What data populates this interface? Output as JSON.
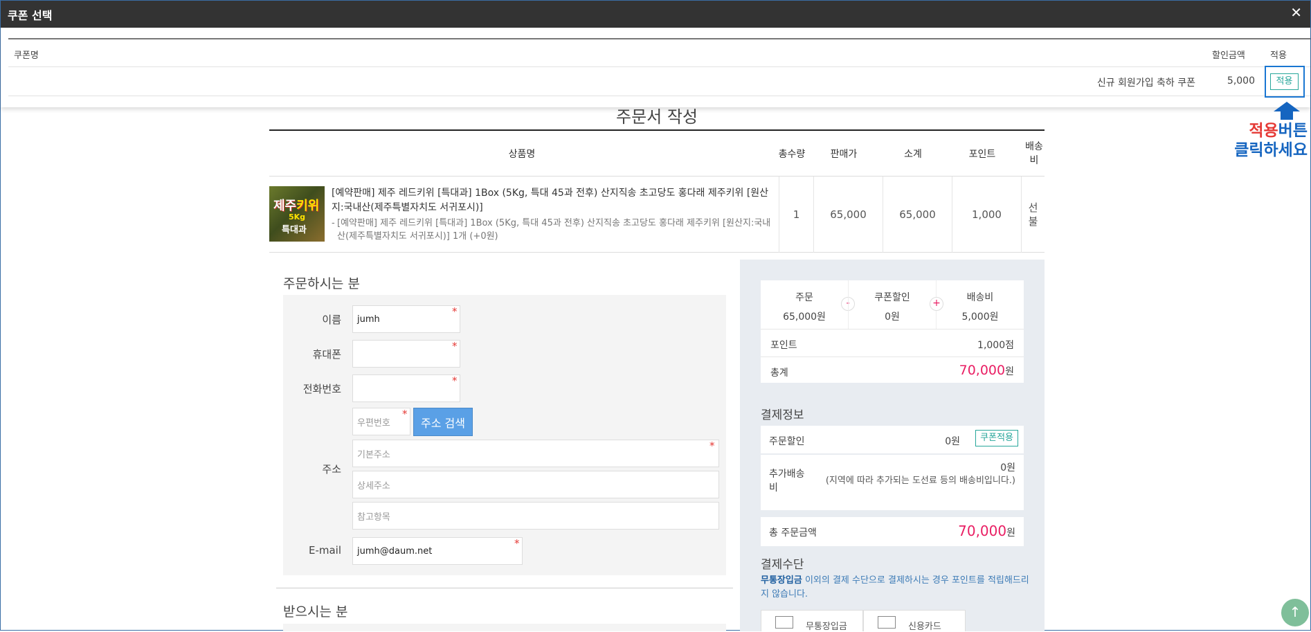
{
  "modal": {
    "title": "쿠폰 선택",
    "close": "✕",
    "columns": {
      "name": "쿠폰명",
      "discount": "할인금액",
      "apply": "적용"
    },
    "coupons": [
      {
        "name": "신규 회원가입 축하 쿠폰",
        "discount": "5,000",
        "apply_label": "적용"
      }
    ]
  },
  "annotation": {
    "red": "적용",
    "blue1": "버튼",
    "blue2": "클릭하세요"
  },
  "order": {
    "title": "주문서 작성",
    "columns": {
      "product": "상품명",
      "qty": "총수량",
      "price": "판매가",
      "subtotal": "소계",
      "point": "포인트",
      "ship": "배송비"
    },
    "item": {
      "thumb_line1a": "제주",
      "thumb_line1b": "키위",
      "thumb_line2": "5Kg",
      "thumb_line3": "특대과",
      "name": "[예약판매] 제주 레드키위 [특대과] 1Box (5Kg, 특대 45과 전후) 산지직송 초고당도 홍다래 제주키위 [원산지:국내산(제주특별자치도 서귀포시)]",
      "option": "[예약판매] 제주 레드키위 [특대과] 1Box (5Kg, 특대 45과 전후) 산지직송 초고당도 홍다래 제주키위 [원산지:국내산(제주특별자치도 서귀포시)] 1개 (+0원)",
      "option_bullet": "-",
      "qty": "1",
      "price": "65,000",
      "subtotal": "65,000",
      "point": "1,000",
      "ship": "선불"
    }
  },
  "orderer": {
    "title": "주문하시는 분",
    "name_label": "이름",
    "name_value": "jumh",
    "phone_label": "휴대폰",
    "tel_label": "전화번호",
    "zip_placeholder": "우편번호",
    "addr_search": "주소 검색",
    "addr_label": "주소",
    "addr1_placeholder": "기본주소",
    "addr2_placeholder": "상세주소",
    "addr3_placeholder": "참고항목",
    "email_label": "E-mail",
    "email_value": "jumh@daum.net",
    "req_mark": "*"
  },
  "receiver": {
    "title": "받으시는 분"
  },
  "summary": {
    "order_label": "주문",
    "order_value": "65,000원",
    "coupon_label": "쿠폰할인",
    "coupon_value": "0원",
    "ship_label": "배송비",
    "ship_value": "5,000원",
    "minus": "-",
    "plus": "+",
    "point_label": "포인트",
    "point_value": "1,000점",
    "total_label": "총계",
    "total_amount": "70,000",
    "total_unit": "원"
  },
  "payinfo": {
    "title": "결제정보",
    "discount_label": "주문할인",
    "discount_value": "0원",
    "coupon_btn": "쿠폰적용",
    "extra_label": "추가배송비",
    "extra_value": "0원",
    "extra_note": "(지역에 따라 추가되는 도선료 등의 배송비입니다.)",
    "grand_label": "총 주문금액",
    "grand_amount": "70,000",
    "grand_unit": "원"
  },
  "paymethod": {
    "title": "결제수단",
    "note_bold": "무통장입금",
    "note_rest": " 이외의 결제 수단으로 결제하시는 경우 포인트를 적립해드리지 않습니다.",
    "m1": "무통장입금",
    "m2": "신용카드"
  },
  "scroll_top": "↑"
}
